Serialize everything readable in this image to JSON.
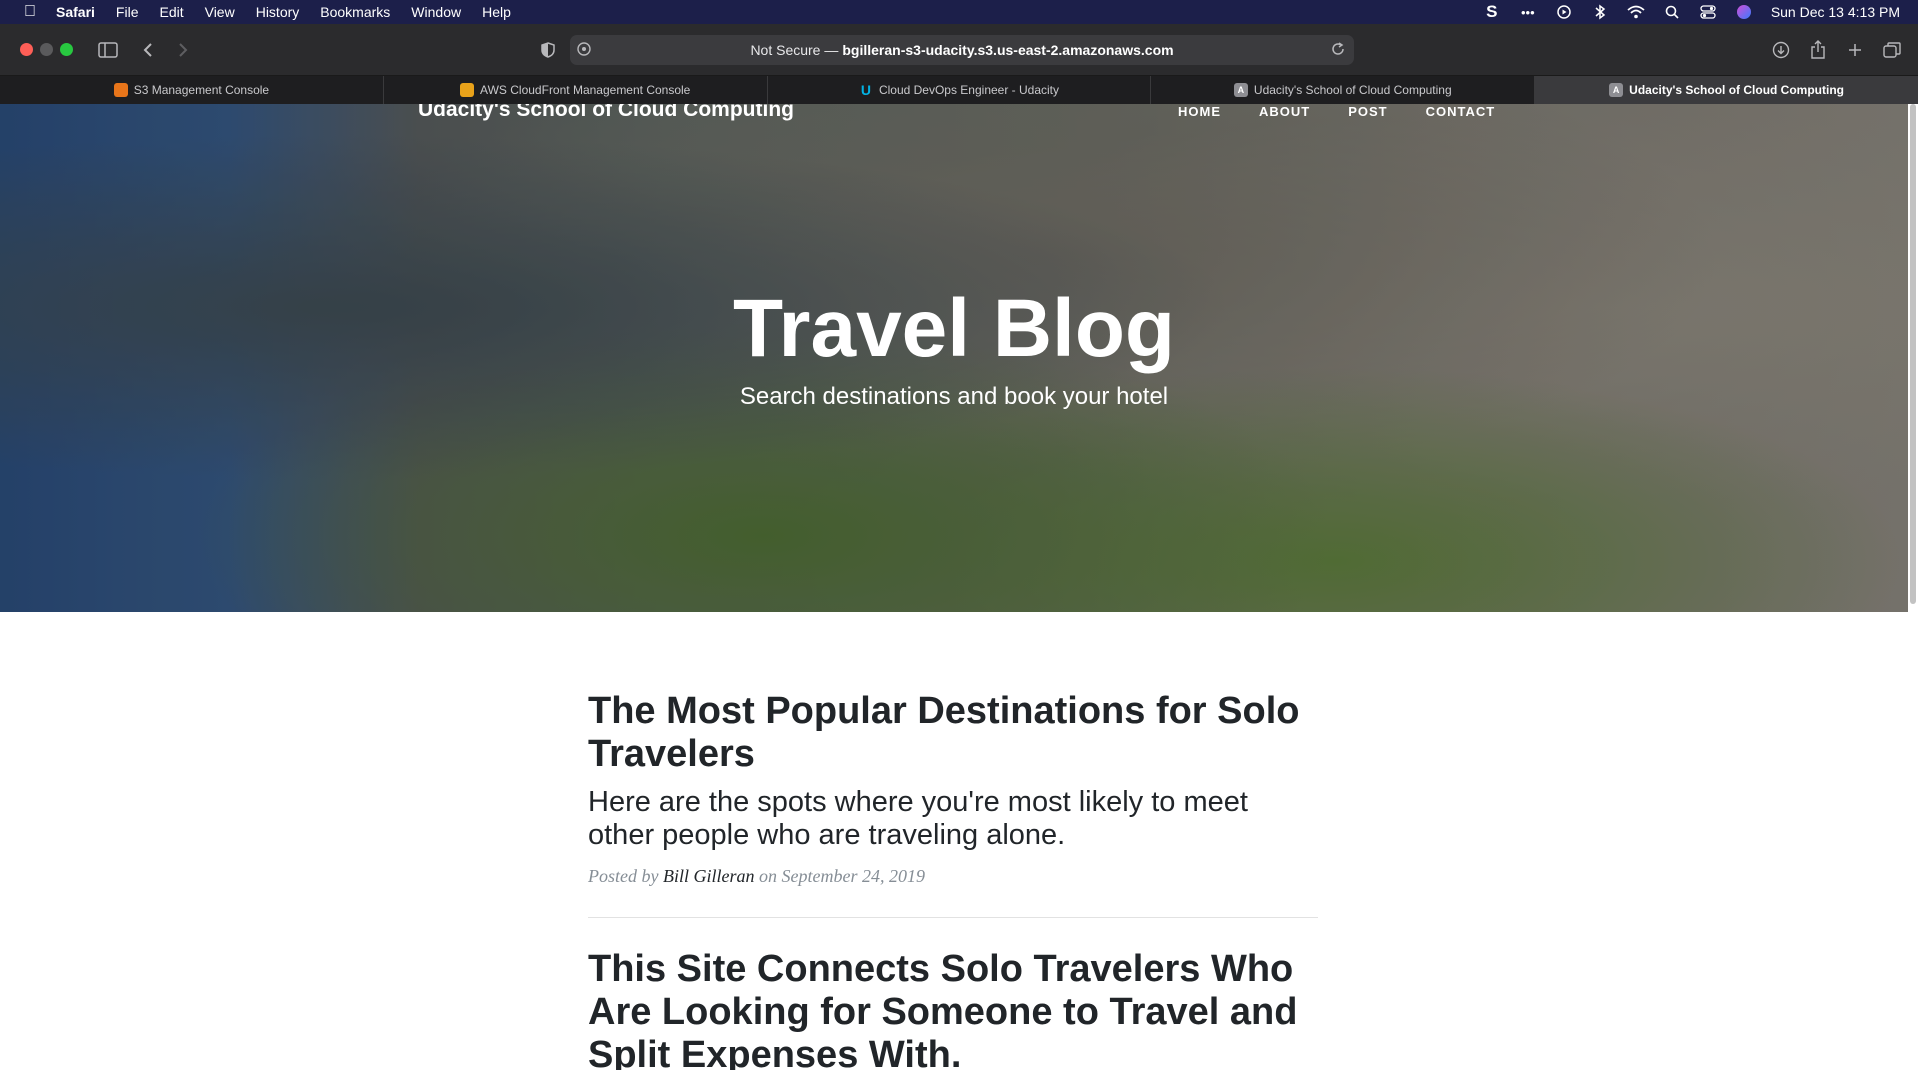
{
  "menubar": {
    "app": "Safari",
    "items": [
      "File",
      "Edit",
      "View",
      "History",
      "Bookmarks",
      "Window",
      "Help"
    ],
    "clock": "Sun Dec 13  4:13 PM",
    "icons": [
      "s-icon",
      "dots-icon",
      "play-icon",
      "bluetooth-icon",
      "wifi-icon",
      "search-icon",
      "control-center-icon",
      "siri-icon"
    ]
  },
  "toolbar": {
    "url_prefix": "Not Secure —",
    "url": "bgilleran-s3-udacity.s3.us-east-2.amazonaws.com"
  },
  "tabs": [
    {
      "label": "S3 Management Console",
      "favicon_color": "#e8751a",
      "favicon_text": ""
    },
    {
      "label": "AWS CloudFront Management Console",
      "favicon_color": "#e8a21a",
      "favicon_text": ""
    },
    {
      "label": "Cloud DevOps Engineer - Udacity",
      "favicon_color": "#02b3e4",
      "favicon_text": "U"
    },
    {
      "label": "Udacity's School of Cloud Computing",
      "favicon_color": "#8e8e93",
      "favicon_text": "A"
    },
    {
      "label": "Udacity's School of Cloud Computing",
      "favicon_color": "#8e8e93",
      "favicon_text": "A"
    }
  ],
  "site": {
    "brand": "Udacity's School of Cloud Computing",
    "nav": [
      "HOME",
      "ABOUT",
      "POST",
      "CONTACT"
    ],
    "hero_title": "Travel Blog",
    "hero_subtitle": "Search destinations and book your hotel"
  },
  "posts": [
    {
      "title": "The Most Popular Destinations for Solo Travelers",
      "subtitle": "Here are the spots where you're most likely to meet other people who are traveling alone.",
      "meta_prefix": "Posted by",
      "author": "Bill Gilleran",
      "meta_suffix": "on September 24, 2019"
    },
    {
      "title": "This Site Connects Solo Travelers Who Are Looking for Someone to Travel and Split Expenses With."
    }
  ]
}
